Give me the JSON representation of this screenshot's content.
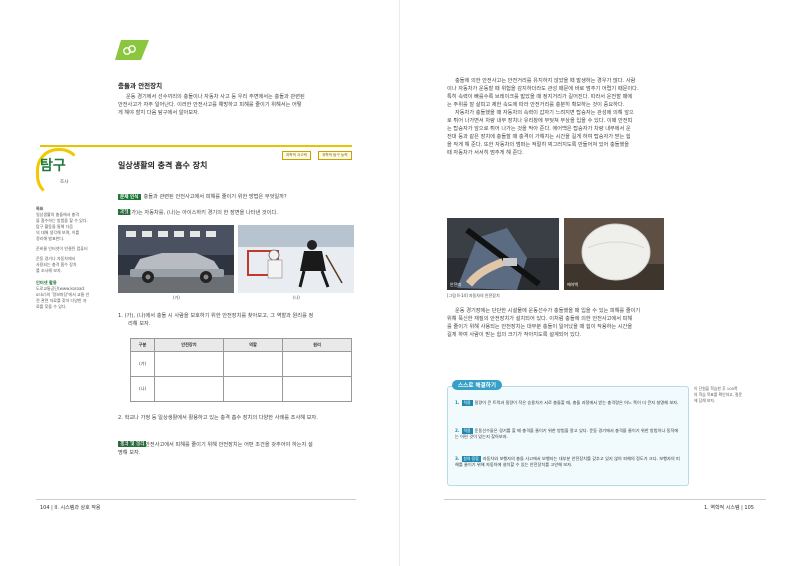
{
  "left": {
    "section_heading": "충돌과 안전장치",
    "section_body": [
      "운동 경기에서 선수끼리의 충돌이나 자동차 사고 등 우리 주변에서는 충돌과 관련된",
      "안전사고가 자주 일어난다. 이러한 안전사고를 예방하고 피해를 줄이기 위해서는 어떻",
      "게 해야 할지 다음 탐구에서 알아보자."
    ],
    "tags": [
      "과학적 사고력",
      "과학적 탐구 능력"
    ],
    "tamgu": "탐구",
    "tamgu_sub": "조사",
    "inquiry_title": "일상생활의 충격 흡수 장치",
    "problem_label": "문제 인식",
    "problem_text": "충돌과 관련된 안전사고에서 피해를 줄이기 위한 방법은 무엇일까?",
    "process_label": "과정",
    "process_text": "그림 (가)는 자동차를, (나)는 아이스하키 경기의 한 장면을 나타낸 것이다.",
    "photo_cap_a": "(가)",
    "photo_cap_b": "(나)",
    "step1": [
      "1. (가), (나)에서 충돌 시 사람을 보호하기 위한 안전장치를 찾아보고, 그 역할과 원리를 정",
      "리해 보자."
    ],
    "table": {
      "headers": [
        "구분",
        "안전장치",
        "역할",
        "원리"
      ],
      "rows": [
        "(가)",
        "(나)"
      ]
    },
    "step2": "2. 학교나 가정 등 일상생활에서 활용하고 있는 충격 흡수 장치의 다양한 사례를 조사해 보자.",
    "result_label": "결과 및 정리",
    "result_text": [
      "충돌에 의한 안전사고에서 피해를 줄이기 위해 안전장치는 어떤 조건을 갖추어야 하는지 설",
      "명해 보자."
    ],
    "side_goal": [
      "목표",
      "일상생활의 충돌에서 충격",
      "을 흡수하는 방법을 할 수 있다.",
      "탐구 활동을 통해 다음",
      "의 대해 생각해 보며, 이를",
      "정리해 발표한다."
    ],
    "side_prep": "준비물 인터넷이 연결된 컴퓨터",
    "side_guide": [
      "운동 경기나 자동차에서",
      "사용되는 충격 흡수 장치",
      "를 조사해 보자."
    ],
    "side_link_title": "인터넷 활용",
    "side_link_text": [
      "도로교통공단(www.koroad.",
      "or.kr)의 '정보마당'에서 교통 안",
      "전 관련 자료를 찾아 다양한 자",
      "료를 찾을 수 있다."
    ],
    "footer": "104  |  II. 시스템과 상호 작용"
  },
  "right": {
    "body1": [
      "충돌에 의한 안전사고는 안전거리를 유지하지 않았을 때 발생하는 경우가 많다. 사람",
      "이나 자동차가 운동할 때 위험을 감지하더라도 관성 때문에 바로 멈추기 어렵기 때문이다.",
      "특히 속력이 빠를수록 브레이크를 밟았을 때 정지거리가 길어진다. 따라서 운전할 때에",
      "는 주위를 잘 살피고 제한 속도에 따라 안전거리를 충분히 확보하는 것이 중요하다.",
      "자동차가 충돌했을 때 자동차의 속력이 갑자기 느려지면 탑승자는 관성에 의해 앞으",
      "로 튀어 나가면서 차량 내부 장치나 유리창에 부딪쳐 부상을 입을 수 있다. 이때 안전띠",
      "는 탑승자가 앞으로 튀어 나가는 것을 막아 준다. 에어백은 탑승자가 차량 내부에서 운",
      "전대 등과 같은 장치에 충돌할 때 충격이 가해지는 시간을 길게 하여 탑승자가 받는 힘",
      "을 작게 해 준다. 또한 자동차의 범퍼는 적절히 찌그러지도록 만들어져 있어 충돌했을",
      "때 자동차가 서서히 멈추게 해 준다."
    ],
    "photo_cap_a": "안전띠",
    "photo_cap_b": "에어백",
    "fig_caption": "[그림 II-14] 자동차의 안전장치",
    "body2": [
      "운동 경기장에는 단단한 시설물에 운동선수가 충돌했을 때 입을 수 있는 피해를 줄이기",
      "위해 푹신한 재질의 안전장치가 설치되어 있다. 이처럼 충돌에 의한 안전사고에서 피해",
      "를 줄이기 위해 사용되는 안전장치는 대부분 충돌이 일어났을 때 힘이 작용하는 시간을",
      "길게 하여 사람이 받는 힘의 크기가 작아지도록 설계되어 있다."
    ],
    "solve_title": "스스로 해결하기",
    "solve_items": [
      {
        "num": "1.",
        "tag": "적용",
        "text": "질량이 큰 트럭과 질량이 작은 승용차가 서로 충돌할 때, 충돌 과정에서 받는 충격량은 어느 쪽이 더 큰지 설명해 보자."
      },
      {
        "num": "2.",
        "tag": "적용",
        "text": "운동선수들은 경기를 할 때 충격을 줄이기 위한 방법을 알고 있다. 운동 경기에서 충격을 줄이기 위한 방법이나 동작에는 어떤 것이 있는지 찾아보자."
      },
      {
        "num": "3.",
        "tag": "창의·융합",
        "text": "자동차와 보행자의 충돌 사고에서 보행자는 대부분 안전장치를 갖추고 있지 않아 피해의 정도가 크다. 보행자의 피해를 줄이기 위해 자동차에 설치할 수 있는 안전장치를 고안해 보자."
      }
    ],
    "side_note": [
      "이 단원을 학습한 후 100쪽",
      "의 학습 목표를 확인하고, 질문",
      "에 답해 보자."
    ],
    "footer": "1. 역학적 시스템  |  105"
  }
}
